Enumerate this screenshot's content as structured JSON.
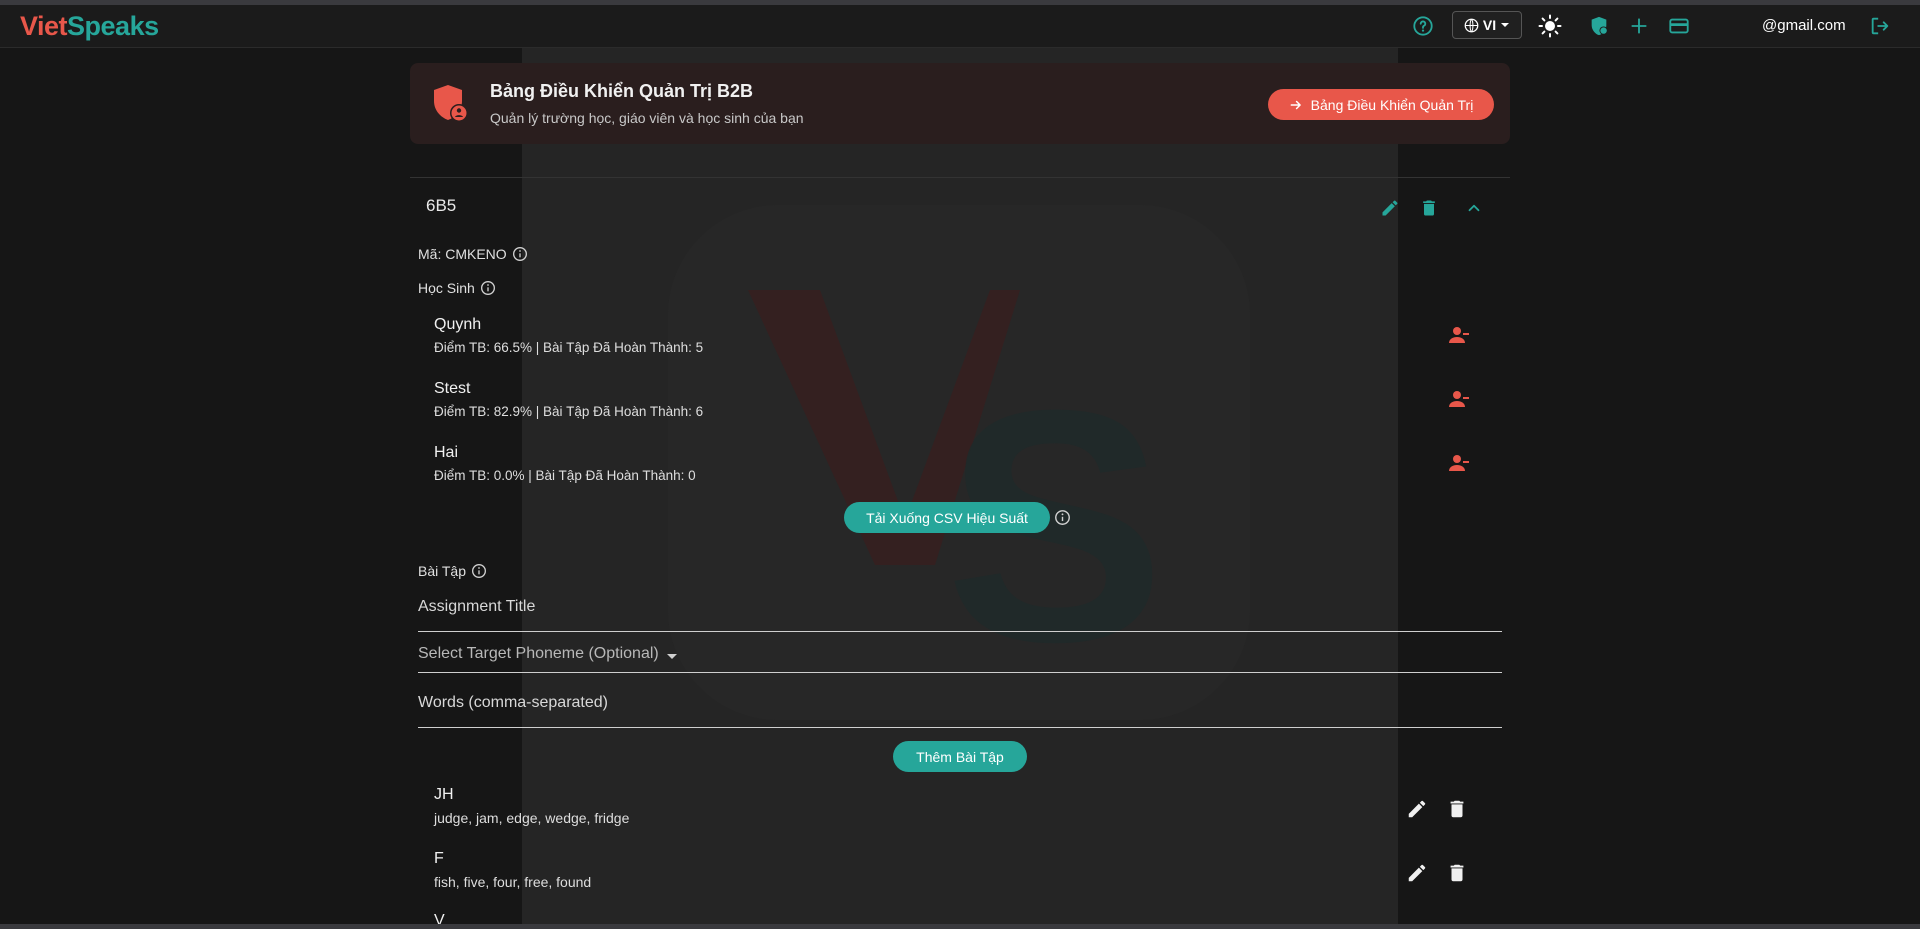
{
  "navbar": {
    "logo_part1": "Viet",
    "logo_part2": "Speaks",
    "language": "VI",
    "email": "@gmail.com",
    "icons": [
      "help-icon",
      "globe-icon",
      "sun-icon",
      "shield-icon",
      "plus-icon",
      "credit-card-icon",
      "logout-icon"
    ]
  },
  "banner": {
    "title": "Bảng Điều Khiển Quản Trị B2B",
    "subtitle": "Quản lý trường học, giáo viên và học sinh của bạn",
    "button_label": "Bảng Điều Khiển Quản Trị"
  },
  "class": {
    "name": "6B5",
    "code_label": "Mã: CMKENO",
    "students_label": "Học Sinh",
    "students": [
      {
        "name": "Quynh",
        "stats": "Điểm TB: 66.5% | Bài Tập Đã Hoàn Thành: 5"
      },
      {
        "name": "Stest",
        "stats": "Điểm TB: 82.9% | Bài Tập Đã Hoàn Thành: 6"
      },
      {
        "name": "Hai",
        "stats": "Điểm TB: 0.0% | Bài Tập Đã Hoàn Thành: 0"
      }
    ],
    "download_csv_label": "Tải Xuống CSV Hiệu Suất",
    "assignments_label": "Bài Tập",
    "form": {
      "title_placeholder": "Assignment Title",
      "phoneme_placeholder": "Select Target Phoneme (Optional)",
      "words_placeholder": "Words (comma-separated)",
      "add_button_label": "Thêm Bài Tập"
    },
    "assignments": [
      {
        "title": "JH",
        "words": "judge, jam, edge, wedge, fridge"
      },
      {
        "title": "F",
        "words": "fish, five, four, free, found"
      },
      {
        "title": "V",
        "words": ""
      }
    ]
  },
  "colors": {
    "accent_teal": "#26a69a",
    "accent_red": "#e8574a",
    "background": "#161616",
    "panel": "#252525"
  }
}
